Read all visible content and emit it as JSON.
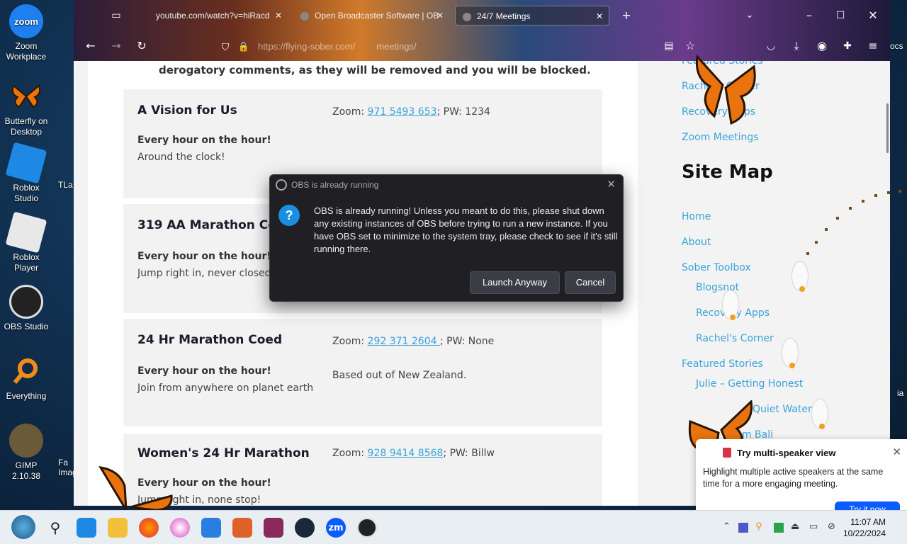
{
  "desktop": {
    "icons": [
      {
        "name": "desktop-icon-zoom",
        "label": "Zoom Workplace"
      },
      {
        "name": "desktop-icon-butterfly",
        "label": "Butterfly on Desktop"
      },
      {
        "name": "desktop-icon-roblox-studio",
        "label": "Roblox Studio"
      },
      {
        "name": "desktop-icon-roblox-player",
        "label": "Roblox Player"
      },
      {
        "name": "desktop-icon-obs",
        "label": "OBS Studio"
      },
      {
        "name": "desktop-icon-everything",
        "label": "Everything"
      },
      {
        "name": "desktop-icon-gimp",
        "label": "GIMP 2.10.38"
      }
    ],
    "partial_icons": [
      "TLa",
      "Fa Imag"
    ],
    "zoom_icon_text": "zoom",
    "edge_text_top": "ocs",
    "edge_text_mid": "ia"
  },
  "browser": {
    "tabs": [
      {
        "label": "youtube.com/watch?v=hiRacd",
        "active": false
      },
      {
        "label": "Open Broadcaster Software | OB",
        "active": false
      },
      {
        "label": "24/7 Meetings",
        "active": true
      }
    ],
    "url_host": "https://flying-sober.com/",
    "url_path": "meetings/",
    "new_tab_glyph": "+",
    "close_glyph": "✕"
  },
  "page": {
    "notice": "derogatory comments, as they will be removed and you will be blocked.",
    "meetings": [
      {
        "title": "A Vision for Us",
        "zoom_prefix": "Zoom: ",
        "zoom_id": "971 5493 653",
        "pw": "; PW: 1234",
        "schedule": "Every hour on the hour!",
        "desc": "Around the clock!",
        "note": ""
      },
      {
        "title": "319 AA Marathon Coed",
        "zoom_prefix": "",
        "zoom_id": "",
        "pw": "",
        "schedule": "Every hour on the hour!",
        "desc": "Jump right in, never closed!",
        "note": ""
      },
      {
        "title": "24 Hr Marathon Coed",
        "zoom_prefix": "Zoom: ",
        "zoom_id": "292 371 2604 ",
        "pw": "; PW: None",
        "schedule": "Every hour on the hour!",
        "desc": "Join from anywhere on planet earth",
        "note": "Based out of New Zealand."
      },
      {
        "title": "Women's 24 Hr Marathon",
        "zoom_prefix": "Zoom: ",
        "zoom_id": "928 9414 8568",
        "pw": "; PW: Billw",
        "schedule": "Every hour on the hour!",
        "desc": "Jump right in, none stop!",
        "note": ""
      }
    ]
  },
  "sidebar": {
    "top_links": [
      "Featured Stories",
      "Rachel's Corner",
      "Recovery Apps",
      "Zoom Meetings"
    ],
    "site_map_title": "Site Map",
    "links": [
      {
        "label": "Home",
        "indent": false
      },
      {
        "label": "About",
        "indent": false
      },
      {
        "label": "Sober Toolbox",
        "indent": false
      },
      {
        "label": "Blogsnot",
        "indent": true
      },
      {
        "label": "Recovery Apps",
        "indent": true
      },
      {
        "label": "Rachel's Corner",
        "indent": true
      },
      {
        "label": "Featured Stories",
        "indent": false
      },
      {
        "label": "Julie – Getting Honest",
        "indent": true
      },
      {
        "label": "Quiet Water",
        "indent": true
      },
      {
        "label": "from Bali",
        "indent": true
      }
    ]
  },
  "dialog": {
    "title": "OBS is already running",
    "message": "OBS is already running! Unless you meant to do this, please shut down any existing instances of OBS before trying to run a new instance. If you have OBS set to minimize to the system tray, please check to see if it's still running there.",
    "launch_label": "Launch Anyway",
    "cancel_label": "Cancel",
    "icon_glyph": "?"
  },
  "toast": {
    "title": "Try multi-speaker view",
    "body": "Highlight multiple active speakers at the same time for a more engaging meeting.",
    "button": "Try it now",
    "close_glyph": "✕"
  },
  "taskbar": {
    "time": "11:07 AM",
    "date": "10/22/2024",
    "zoom_label": "zm"
  }
}
